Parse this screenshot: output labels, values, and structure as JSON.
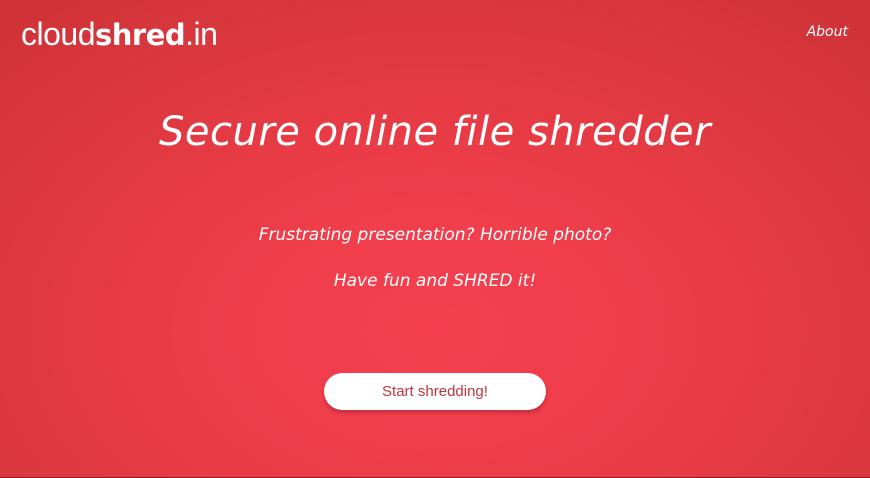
{
  "header": {
    "logo": {
      "part_light": "cloud",
      "part_bold": "shred",
      "part_tld": ".in"
    },
    "nav": {
      "about_label": "About"
    }
  },
  "hero": {
    "title": "Secure online file shredder",
    "tagline_1": "Frustrating presentation? Horrible photo?",
    "tagline_2": "Have fun and SHRED it!",
    "cta_label": "Start shredding!"
  },
  "colors": {
    "background": "#ee3d4a",
    "button_bg": "#ffffff",
    "button_text": "#c0343b",
    "text": "#ffffff"
  }
}
